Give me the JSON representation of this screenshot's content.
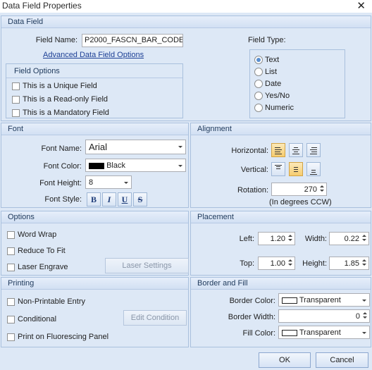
{
  "window": {
    "title": "Data Field Properties",
    "close_glyph": "✕"
  },
  "data_field": {
    "header": "Data Field",
    "field_name_label": "Field Name:",
    "field_name_value": "P2000_FASCN_BAR_CODE_",
    "advanced_link": "Advanced Data Field Options",
    "field_type_label": "Field Type:",
    "field_types": [
      {
        "label": "Text",
        "selected": true
      },
      {
        "label": "List",
        "selected": false
      },
      {
        "label": "Date",
        "selected": false
      },
      {
        "label": "Yes/No",
        "selected": false
      },
      {
        "label": "Numeric",
        "selected": false
      }
    ],
    "field_options": {
      "header": "Field Options",
      "items": [
        {
          "label": "This is a Unique Field",
          "checked": false
        },
        {
          "label": "This is a Read-only Field",
          "checked": false
        },
        {
          "label": "This is a Mandatory Field",
          "checked": false
        }
      ]
    }
  },
  "font": {
    "header": "Font",
    "name_label": "Font Name:",
    "name_value": "Arial",
    "color_label": "Font Color:",
    "color_value": "Black",
    "color_hex": "#000000",
    "height_label": "Font Height:",
    "height_value": "8",
    "style_label": "Font Style:",
    "style_buttons": [
      {
        "glyph": "B",
        "icon": "bold-icon"
      },
      {
        "glyph": "I",
        "icon": "italic-icon"
      },
      {
        "glyph": "U",
        "icon": "underline-icon"
      },
      {
        "glyph": "S",
        "icon": "strikethrough-icon"
      }
    ]
  },
  "alignment": {
    "header": "Alignment",
    "horizontal_label": "Horizontal:",
    "vertical_label": "Vertical:",
    "rotation_label": "Rotation:",
    "rotation_value": "270",
    "rotation_note": "(In degrees CCW)",
    "horizontal_icons": [
      "align-left-icon",
      "align-center-icon",
      "align-right-icon"
    ],
    "vertical_icons": [
      "align-top-icon",
      "align-middle-icon",
      "align-bottom-icon"
    ]
  },
  "options": {
    "header": "Options",
    "items": [
      {
        "label": "Word Wrap",
        "checked": false
      },
      {
        "label": "Reduce To Fit",
        "checked": false
      },
      {
        "label": "Laser Engrave",
        "checked": false
      }
    ],
    "laser_settings_button": "Laser Settings"
  },
  "placement": {
    "header": "Placement",
    "left_label": "Left:",
    "left_value": "1.20",
    "width_label": "Width:",
    "width_value": "0.22",
    "top_label": "Top:",
    "top_value": "1.00",
    "height_label": "Height:",
    "height_value": "1.85"
  },
  "printing": {
    "header": "Printing",
    "items": [
      {
        "label": "Non-Printable Entry",
        "checked": false
      },
      {
        "label": "Conditional",
        "checked": false
      },
      {
        "label": "Print on Fluorescing Panel",
        "checked": false
      }
    ],
    "edit_condition_button": "Edit Condition"
  },
  "border_fill": {
    "header": "Border and Fill",
    "border_color_label": "Border Color:",
    "border_color_value": "Transparent",
    "border_width_label": "Border Width:",
    "border_width_value": "0",
    "fill_color_label": "Fill Color:",
    "fill_color_value": "Transparent"
  },
  "footer": {
    "ok_label": "OK",
    "cancel_label": "Cancel"
  },
  "colors": {
    "panel_bg": "#dde8f6",
    "header_text": "#1e395b",
    "link": "#1c3f95",
    "radio_dot": "#5a8fd0"
  }
}
